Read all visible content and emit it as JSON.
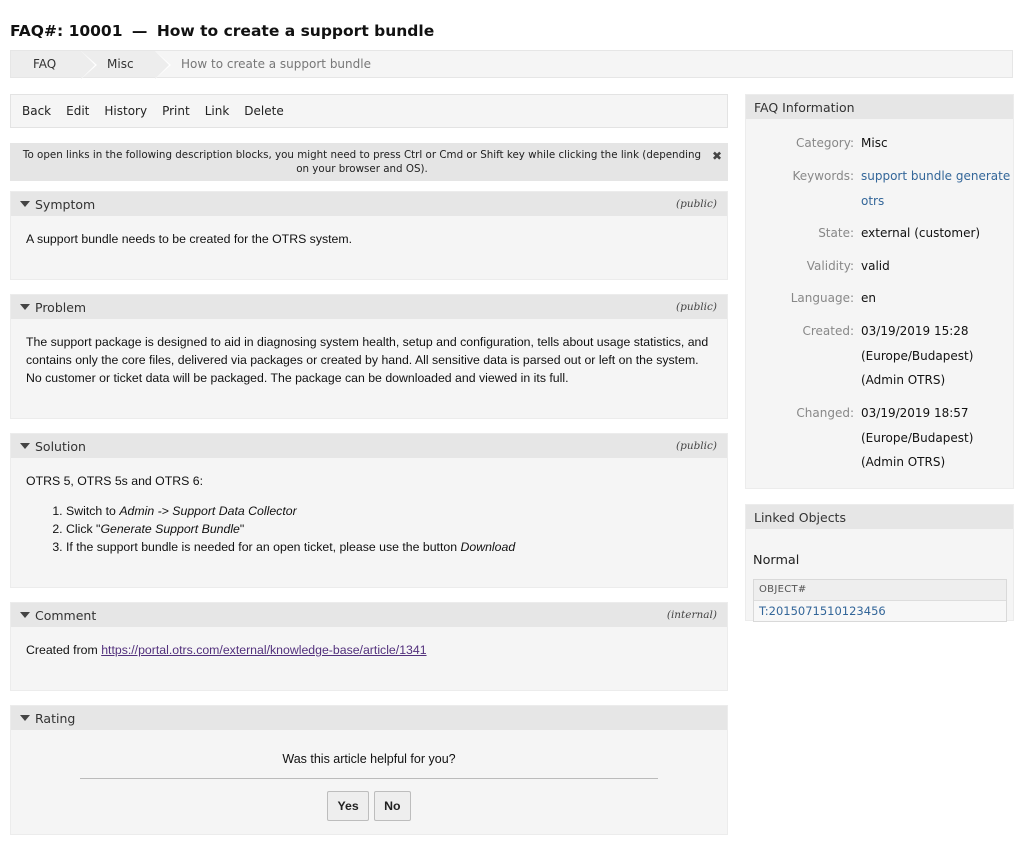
{
  "title": {
    "prefix": "FAQ#: 10001",
    "dash": "—",
    "text": "How to create a support bundle"
  },
  "breadcrumb": [
    "FAQ",
    "Misc",
    "How to create a support bundle"
  ],
  "actions": [
    "Back",
    "Edit",
    "History",
    "Print",
    "Link",
    "Delete"
  ],
  "notice": {
    "text": "To open links in the following description blocks, you might need to press Ctrl or Cmd or Shift key while clicking the link (depending on your browser and OS).",
    "close": "✖"
  },
  "symptom": {
    "title": "Symptom",
    "visibility": "(public)",
    "text": "A support bundle needs to be created for the OTRS system."
  },
  "problem": {
    "title": "Problem",
    "visibility": "(public)",
    "text": "The support package is designed to aid in diagnosing system health, setup and configuration, tells about usage statistics, and contains only the core files, delivered via packages or created by hand. All sensitive data is parsed out or left on the system. No customer or ticket data will be packaged. The package can be downloaded and viewed in its full."
  },
  "solution": {
    "title": "Solution",
    "visibility": "(public)",
    "intro": "OTRS 5, OTRS 5s and OTRS 6:",
    "step1": {
      "a": "Switch to ",
      "b": "Admin -> Support Data Collector"
    },
    "step2": {
      "a": "Click \"",
      "b": "Generate Support Bundle",
      "c": "\""
    },
    "step3": {
      "a": "If the support bundle is needed for an open ticket, please use the button ",
      "b": "Download"
    }
  },
  "comment": {
    "title": "Comment",
    "visibility": "(internal)",
    "prefix": "Created from ",
    "link": "https://portal.otrs.com/external/knowledge-base/article/1341"
  },
  "rating": {
    "title": "Rating",
    "question": "Was this article helpful for you?",
    "yes": "Yes",
    "no": "No"
  },
  "faq_info": {
    "title": "FAQ Information",
    "category_label": "Category:",
    "category": "Misc",
    "keywords_label": "Keywords:",
    "keywords": "support bundle generate otrs",
    "state_label": "State:",
    "state": "external (customer)",
    "validity_label": "Validity:",
    "validity": "valid",
    "language_label": "Language:",
    "language": "en",
    "created_label": "Created:",
    "created_date": "03/19/2019 15:28",
    "created_tz": "(Europe/Budapest)",
    "created_by": "(Admin OTRS)",
    "changed_label": "Changed:",
    "changed_date": "03/19/2019 18:57",
    "changed_tz": "(Europe/Budapest)",
    "changed_by": "(Admin OTRS)"
  },
  "linked": {
    "title": "Linked Objects",
    "group": "Normal",
    "column": "OBJECT#",
    "value": "T:2015071510123456"
  }
}
